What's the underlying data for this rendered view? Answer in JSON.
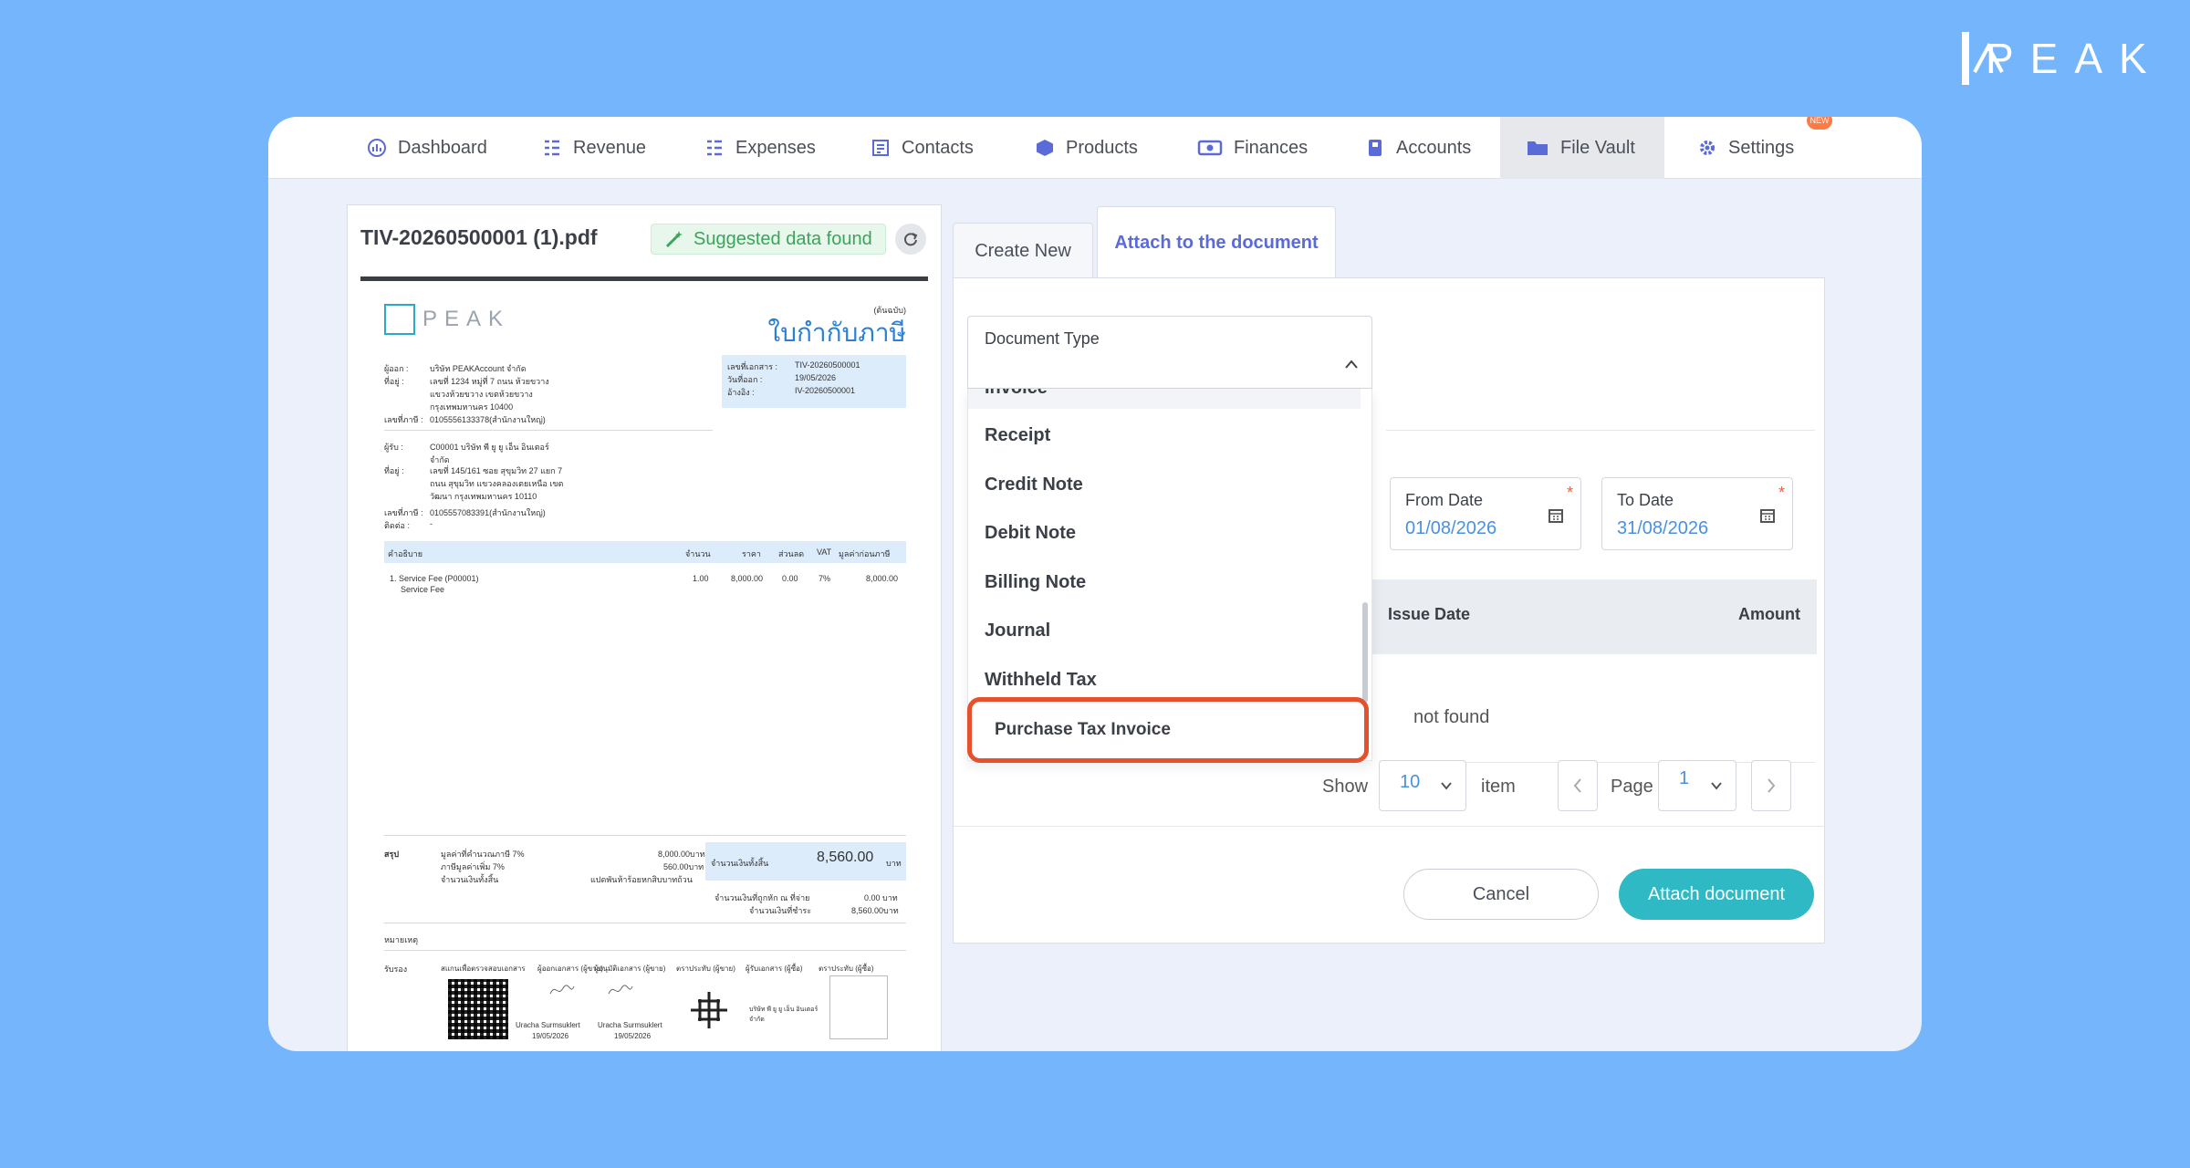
{
  "brand": {
    "name": "PEAK"
  },
  "nav": {
    "items": [
      {
        "label": "Dashboard",
        "icon": "dashboard-icon"
      },
      {
        "label": "Revenue",
        "icon": "revenue-icon"
      },
      {
        "label": "Expenses",
        "icon": "expenses-icon"
      },
      {
        "label": "Contacts",
        "icon": "contacts-icon"
      },
      {
        "label": "Products",
        "icon": "products-icon"
      },
      {
        "label": "Finances",
        "icon": "finances-icon"
      },
      {
        "label": "Accounts",
        "icon": "accounts-icon"
      },
      {
        "label": "File Vault",
        "icon": "folder-icon",
        "active": true
      },
      {
        "label": "Settings",
        "icon": "gear-icon",
        "badge": "NEW"
      }
    ]
  },
  "file": {
    "name": "TIV-20260500001 (1).pdf",
    "suggestion": "Suggested data found"
  },
  "preview": {
    "logo": "PEAK",
    "title": "ใบกำกับภาษี",
    "original": "(ต้นฉบับ)",
    "issuer_label": "ผู้ออก :",
    "issuer": "บริษัท PEAKAccount จำกัด",
    "address_label": "ที่อยู่ :",
    "issuer_address": "เลขที่ 1234 หมู่ที่ 7 ถนน ห้วยขวาง แขวงห้วยขวาง เขตห้วยขวาง กรุงเทพมหานคร 10400",
    "tax_label": "เลขที่ภาษี :",
    "issuer_tax": "0105556133378(สำนักงานใหญ่)",
    "doc_no_label": "เลขที่เอกสาร :",
    "doc_no": "TIV-20260500001",
    "issue_label": "วันที่ออก :",
    "issue_date": "19/05/2026",
    "ref_label": "อ้างอิง :",
    "ref": "IV-20260500001",
    "customer_label": "ผู้รับ :",
    "customer": "C00001 บริษัท พี ยู ยู เอ็น อินเตอร์ จำกัด",
    "customer_address": "เลขที่ 145/161 ซอย สุขุมวิท 27 แยก 7 ถนน สุขุมวิท แขวงคลองเตยเหนือ เขตวัฒนา กรุงเทพมหานคร 10110",
    "customer_tax": "0105557083391(สำนักงานใหญ่)",
    "contact_label": "ติดต่อ :",
    "contact": "-",
    "columns": [
      "คำอธิบาย",
      "จำนวน",
      "ราคา",
      "ส่วนลด",
      "VAT",
      "มูลค่าก่อนภาษี"
    ],
    "row": {
      "desc": "1. Service Fee (P00001)",
      "sub": "Service Fee",
      "qty": "1.00",
      "price": "8,000.00",
      "disc": "0.00",
      "vat": "7%",
      "amount": "8,000.00"
    },
    "summary_label": "สรุป",
    "vat_base_label": "มูลค่าที่คำนวณภาษี 7%",
    "vat_base": "8,000.00บาท",
    "vat_label": "ภาษีมูลค่าเพิ่ม 7%",
    "vat_value": "560.00บาท",
    "total_label": "จำนวนเงินทั้งสิ้น",
    "total_text": "แปดพันห้าร้อยหกสิบบาทถ้วน",
    "grand_total_label": "จำนวนเงินทั้งสิ้น",
    "grand_total": "8,560.00",
    "currency": "บาท",
    "wht_label": "จำนวนเงินที่ถูกหัก ณ ที่จ่าย",
    "wht": "0.00 บาท",
    "paid_label": "จำนวนเงินที่ชำระ",
    "paid": "8,560.00บาท",
    "notes_label": "หมายเหตุ",
    "sign_label": "รับรอง",
    "sign_cols": [
      "สแกนเพื่อตรวจสอบเอกสาร",
      "ผู้ออกเอกสาร (ผู้ขาย)",
      "ผู้อนุมัติเอกสาร (ผู้ขาย)",
      "ตราประทับ (ผู้ขาย)",
      "ผู้รับเอกสาร (ผู้ซื้อ)",
      "ตราประทับ (ผู้ซื้อ)"
    ],
    "signer1": "Uracha Surmsuklert",
    "signer2": "Uracha Surmsuklert",
    "sign_date": "19/05/2026",
    "buyer_company": "บริษัท พี ยู ยู เอ็น อินเตอร์ จำกัด"
  },
  "tabs": {
    "create": "Create New",
    "attach": "Attach to the document"
  },
  "filters": {
    "from_label": "From Date",
    "from_value": "01/08/2026",
    "to_label": "To Date",
    "to_value": "31/08/2026"
  },
  "table": {
    "issue_date": "Issue Date",
    "amount": "Amount",
    "empty": "not found"
  },
  "pagination": {
    "show": "Show",
    "per_page": "10",
    "item": "item",
    "page": "Page",
    "current": "1"
  },
  "actions": {
    "cancel": "Cancel",
    "attach": "Attach document"
  },
  "dropdown": {
    "label": "Document Type",
    "partial_item": "Invoice",
    "items": [
      "Receipt",
      "Credit Note",
      "Debit Note",
      "Billing Note",
      "Journal",
      "Withheld Tax"
    ],
    "highlighted": "Purchase Tax Invoice"
  },
  "colors": {
    "background": "#74b5fc",
    "accent": "#2fb9c4",
    "highlight": "#e5512d",
    "tab_active": "#5a6bd8"
  }
}
